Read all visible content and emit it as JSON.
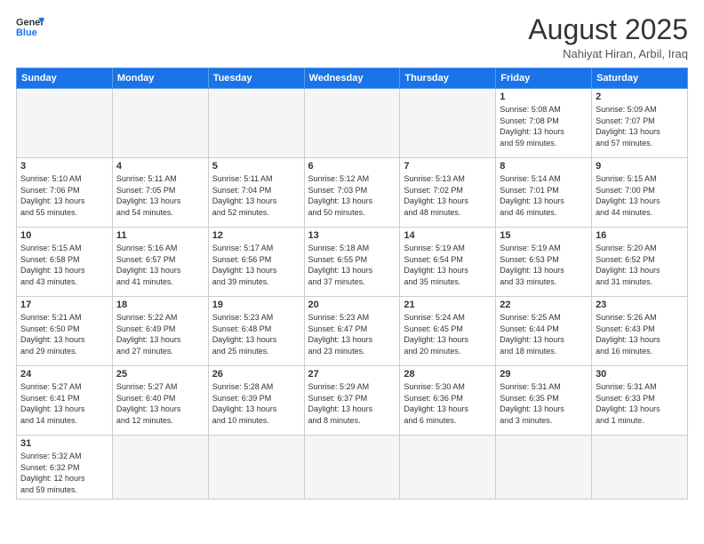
{
  "header": {
    "logo_general": "General",
    "logo_blue": "Blue",
    "month_title": "August 2025",
    "location": "Nahiyat Hiran, Arbil, Iraq"
  },
  "weekdays": [
    "Sunday",
    "Monday",
    "Tuesday",
    "Wednesday",
    "Thursday",
    "Friday",
    "Saturday"
  ],
  "weeks": [
    [
      {
        "day": "",
        "info": ""
      },
      {
        "day": "",
        "info": ""
      },
      {
        "day": "",
        "info": ""
      },
      {
        "day": "",
        "info": ""
      },
      {
        "day": "",
        "info": ""
      },
      {
        "day": "1",
        "info": "Sunrise: 5:08 AM\nSunset: 7:08 PM\nDaylight: 13 hours\nand 59 minutes."
      },
      {
        "day": "2",
        "info": "Sunrise: 5:09 AM\nSunset: 7:07 PM\nDaylight: 13 hours\nand 57 minutes."
      }
    ],
    [
      {
        "day": "3",
        "info": "Sunrise: 5:10 AM\nSunset: 7:06 PM\nDaylight: 13 hours\nand 55 minutes."
      },
      {
        "day": "4",
        "info": "Sunrise: 5:11 AM\nSunset: 7:05 PM\nDaylight: 13 hours\nand 54 minutes."
      },
      {
        "day": "5",
        "info": "Sunrise: 5:11 AM\nSunset: 7:04 PM\nDaylight: 13 hours\nand 52 minutes."
      },
      {
        "day": "6",
        "info": "Sunrise: 5:12 AM\nSunset: 7:03 PM\nDaylight: 13 hours\nand 50 minutes."
      },
      {
        "day": "7",
        "info": "Sunrise: 5:13 AM\nSunset: 7:02 PM\nDaylight: 13 hours\nand 48 minutes."
      },
      {
        "day": "8",
        "info": "Sunrise: 5:14 AM\nSunset: 7:01 PM\nDaylight: 13 hours\nand 46 minutes."
      },
      {
        "day": "9",
        "info": "Sunrise: 5:15 AM\nSunset: 7:00 PM\nDaylight: 13 hours\nand 44 minutes."
      }
    ],
    [
      {
        "day": "10",
        "info": "Sunrise: 5:15 AM\nSunset: 6:58 PM\nDaylight: 13 hours\nand 43 minutes."
      },
      {
        "day": "11",
        "info": "Sunrise: 5:16 AM\nSunset: 6:57 PM\nDaylight: 13 hours\nand 41 minutes."
      },
      {
        "day": "12",
        "info": "Sunrise: 5:17 AM\nSunset: 6:56 PM\nDaylight: 13 hours\nand 39 minutes."
      },
      {
        "day": "13",
        "info": "Sunrise: 5:18 AM\nSunset: 6:55 PM\nDaylight: 13 hours\nand 37 minutes."
      },
      {
        "day": "14",
        "info": "Sunrise: 5:19 AM\nSunset: 6:54 PM\nDaylight: 13 hours\nand 35 minutes."
      },
      {
        "day": "15",
        "info": "Sunrise: 5:19 AM\nSunset: 6:53 PM\nDaylight: 13 hours\nand 33 minutes."
      },
      {
        "day": "16",
        "info": "Sunrise: 5:20 AM\nSunset: 6:52 PM\nDaylight: 13 hours\nand 31 minutes."
      }
    ],
    [
      {
        "day": "17",
        "info": "Sunrise: 5:21 AM\nSunset: 6:50 PM\nDaylight: 13 hours\nand 29 minutes."
      },
      {
        "day": "18",
        "info": "Sunrise: 5:22 AM\nSunset: 6:49 PM\nDaylight: 13 hours\nand 27 minutes."
      },
      {
        "day": "19",
        "info": "Sunrise: 5:23 AM\nSunset: 6:48 PM\nDaylight: 13 hours\nand 25 minutes."
      },
      {
        "day": "20",
        "info": "Sunrise: 5:23 AM\nSunset: 6:47 PM\nDaylight: 13 hours\nand 23 minutes."
      },
      {
        "day": "21",
        "info": "Sunrise: 5:24 AM\nSunset: 6:45 PM\nDaylight: 13 hours\nand 20 minutes."
      },
      {
        "day": "22",
        "info": "Sunrise: 5:25 AM\nSunset: 6:44 PM\nDaylight: 13 hours\nand 18 minutes."
      },
      {
        "day": "23",
        "info": "Sunrise: 5:26 AM\nSunset: 6:43 PM\nDaylight: 13 hours\nand 16 minutes."
      }
    ],
    [
      {
        "day": "24",
        "info": "Sunrise: 5:27 AM\nSunset: 6:41 PM\nDaylight: 13 hours\nand 14 minutes."
      },
      {
        "day": "25",
        "info": "Sunrise: 5:27 AM\nSunset: 6:40 PM\nDaylight: 13 hours\nand 12 minutes."
      },
      {
        "day": "26",
        "info": "Sunrise: 5:28 AM\nSunset: 6:39 PM\nDaylight: 13 hours\nand 10 minutes."
      },
      {
        "day": "27",
        "info": "Sunrise: 5:29 AM\nSunset: 6:37 PM\nDaylight: 13 hours\nand 8 minutes."
      },
      {
        "day": "28",
        "info": "Sunrise: 5:30 AM\nSunset: 6:36 PM\nDaylight: 13 hours\nand 6 minutes."
      },
      {
        "day": "29",
        "info": "Sunrise: 5:31 AM\nSunset: 6:35 PM\nDaylight: 13 hours\nand 3 minutes."
      },
      {
        "day": "30",
        "info": "Sunrise: 5:31 AM\nSunset: 6:33 PM\nDaylight: 13 hours\nand 1 minute."
      }
    ],
    [
      {
        "day": "31",
        "info": "Sunrise: 5:32 AM\nSunset: 6:32 PM\nDaylight: 12 hours\nand 59 minutes."
      },
      {
        "day": "",
        "info": ""
      },
      {
        "day": "",
        "info": ""
      },
      {
        "day": "",
        "info": ""
      },
      {
        "day": "",
        "info": ""
      },
      {
        "day": "",
        "info": ""
      },
      {
        "day": "",
        "info": ""
      }
    ]
  ]
}
